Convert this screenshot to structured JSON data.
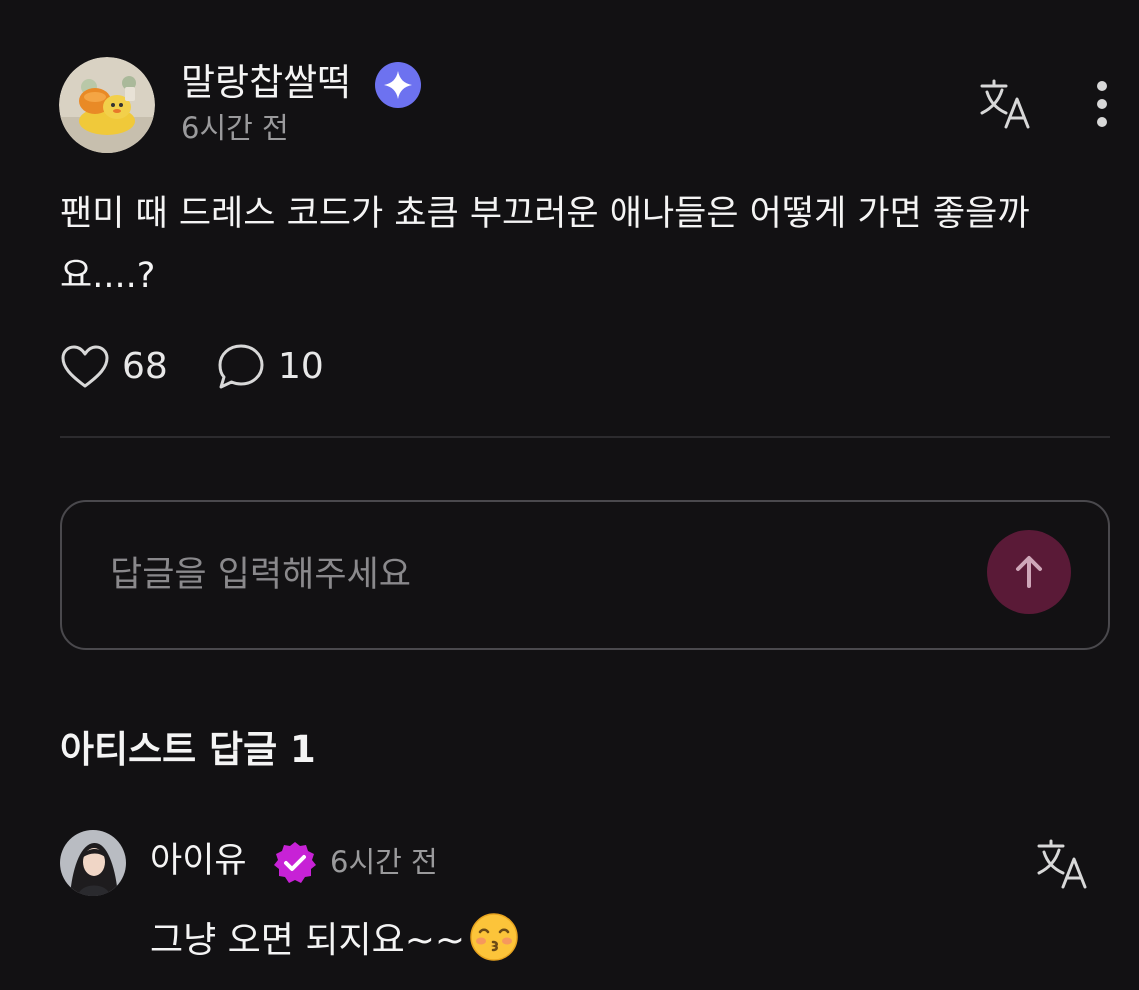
{
  "post": {
    "author": {
      "name": "말랑찹쌀떡",
      "avatar_icon": "cartoon-character-avatar",
      "badge_icon": "sparkle-badge-icon"
    },
    "time": "6시간 전",
    "body": "팬미 때 드레스 코드가 쵸큼 부끄러운 애나들은 어떻게 가면 좋을까요....?",
    "likes": "68",
    "comments": "10"
  },
  "reply_input": {
    "placeholder": "답글을 입력해주세요"
  },
  "artist_replies": {
    "title": "아티스트 답글 1",
    "items": [
      {
        "author": "아이유",
        "badge_icon": "verified-check-badge-icon",
        "time": "6시간 전",
        "text": "그냥 오면 되지요~~",
        "emoji_icon": "kissing-face-emoji"
      }
    ]
  },
  "colors": {
    "background": "#121113",
    "text": "#f4f4f4",
    "muted": "#9a9a9c",
    "sparkle_badge": "#6d72f0",
    "verified_badge": "#c722d6",
    "send_button": "#5a1a37"
  }
}
